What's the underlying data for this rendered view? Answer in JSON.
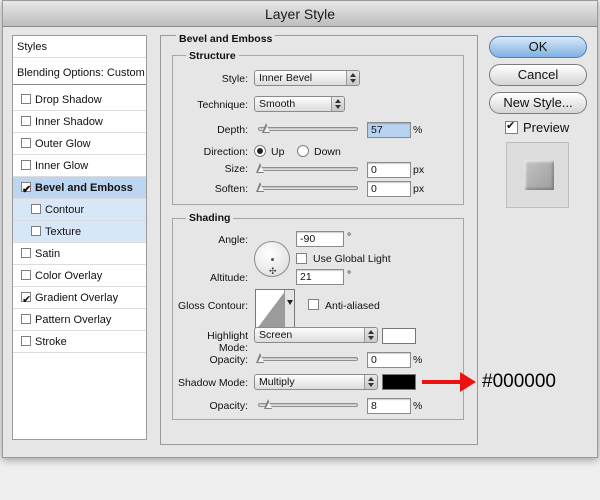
{
  "window": {
    "title": "Layer Style"
  },
  "sidebar": {
    "header": "Styles",
    "blending": "Blending Options: Custom",
    "items": [
      {
        "label": "Drop Shadow",
        "checked": false
      },
      {
        "label": "Inner Shadow",
        "checked": false
      },
      {
        "label": "Outer Glow",
        "checked": false
      },
      {
        "label": "Inner Glow",
        "checked": false
      },
      {
        "label": "Bevel and Emboss",
        "checked": true,
        "selected": true
      },
      {
        "label": "Contour",
        "checked": false,
        "sub": true
      },
      {
        "label": "Texture",
        "checked": false,
        "sub": true
      },
      {
        "label": "Satin",
        "checked": false
      },
      {
        "label": "Color Overlay",
        "checked": false
      },
      {
        "label": "Gradient Overlay",
        "checked": true
      },
      {
        "label": "Pattern Overlay",
        "checked": false
      },
      {
        "label": "Stroke",
        "checked": false
      }
    ]
  },
  "panel": {
    "title": "Bevel and Emboss",
    "structure": {
      "title": "Structure",
      "style_label": "Style:",
      "style_value": "Inner Bevel",
      "technique_label": "Technique:",
      "technique_value": "Smooth",
      "depth_label": "Depth:",
      "depth_value": "57",
      "depth_unit": "%",
      "depth_level": 0.057,
      "direction_label": "Direction:",
      "up_label": "Up",
      "down_label": "Down",
      "direction_value": "Up",
      "size_label": "Size:",
      "size_value": "0",
      "size_unit": "px",
      "soften_label": "Soften:",
      "soften_value": "0",
      "soften_unit": "px"
    },
    "shading": {
      "title": "Shading",
      "angle_label": "Angle:",
      "angle_value": "-90",
      "angle_unit": "°",
      "global_light_label": "Use Global Light",
      "global_light_checked": false,
      "altitude_label": "Altitude:",
      "altitude_value": "21",
      "altitude_unit": "°",
      "gloss_label": "Gloss Contour:",
      "antialiased_label": "Anti-aliased",
      "antialiased_checked": false,
      "highlight_label": "Highlight Mode:",
      "highlight_value": "Screen",
      "highlight_color": "#ffffff",
      "highlight_opacity_label": "Opacity:",
      "highlight_opacity_value": "0",
      "highlight_opacity_unit": "%",
      "shadow_label": "Shadow Mode:",
      "shadow_value": "Multiply",
      "shadow_color": "#000000",
      "shadow_opacity_label": "Opacity:",
      "shadow_opacity_value": "8",
      "shadow_opacity_unit": "%"
    }
  },
  "buttons": {
    "ok": "OK",
    "cancel": "Cancel",
    "new_style": "New Style...",
    "preview_label": "Preview",
    "preview_checked": true
  },
  "annotation": {
    "text": "#000000",
    "arrow_color": "#ee1111"
  }
}
